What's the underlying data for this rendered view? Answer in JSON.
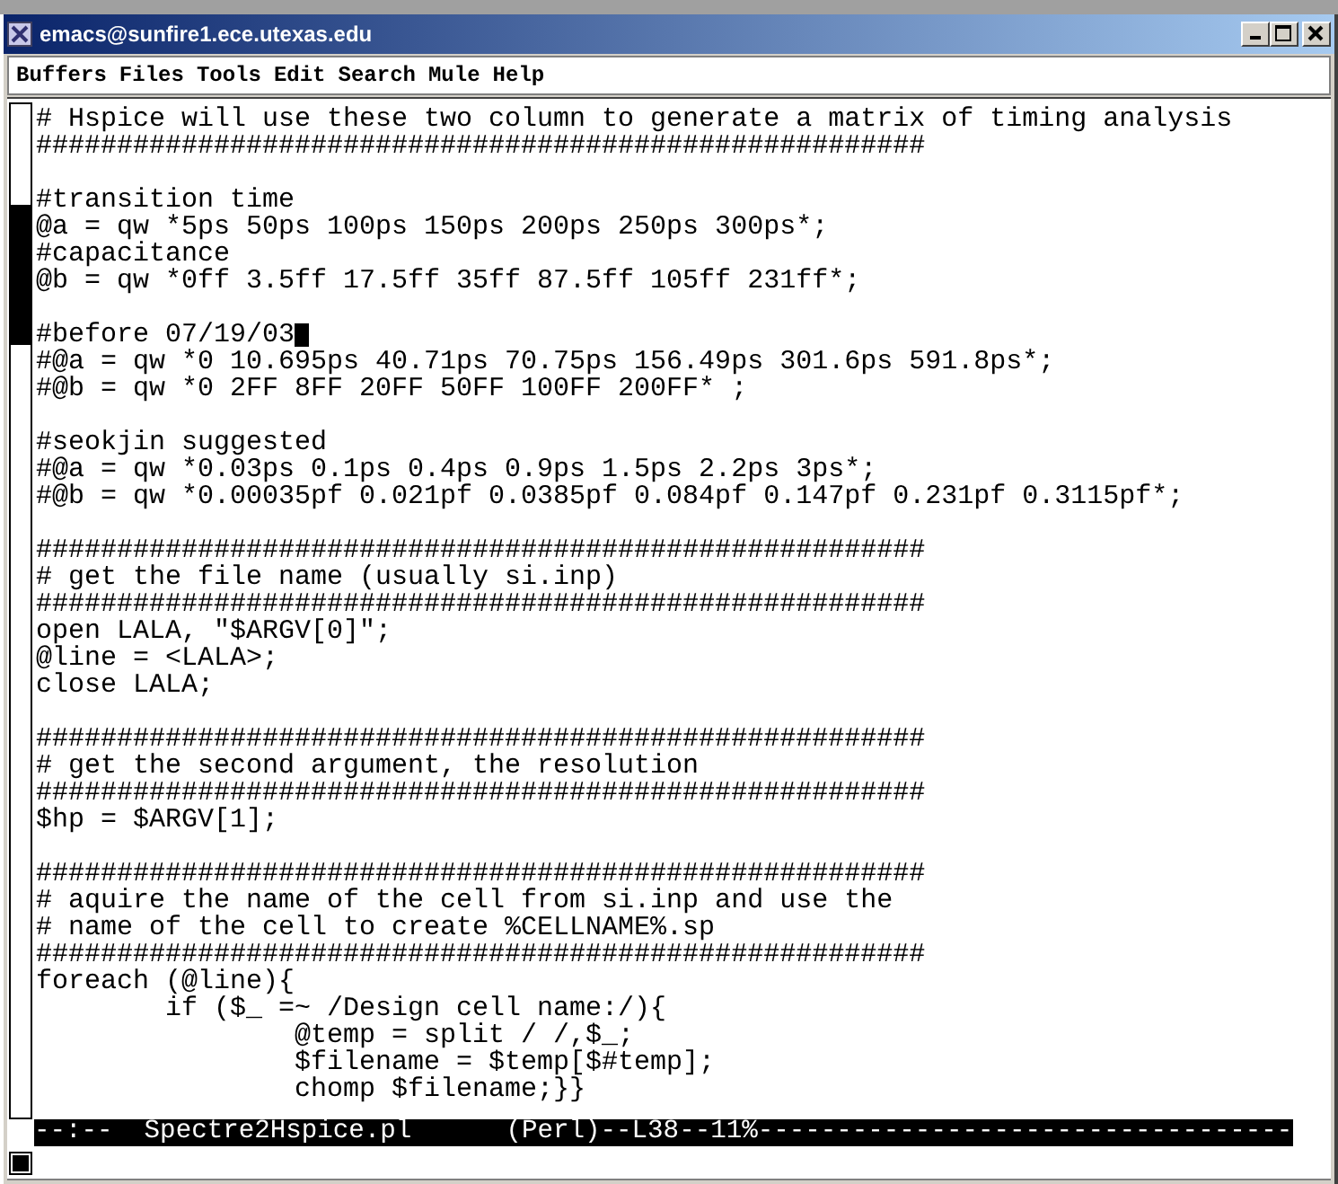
{
  "window": {
    "title": "emacs@sunfire1.ece.utexas.edu"
  },
  "menu": [
    "Buffers",
    "Files",
    "Tools",
    "Edit",
    "Search",
    "Mule",
    "Help"
  ],
  "buffer": {
    "blocks": [
      [
        {
          "text": "# Hspice will use these two column to generate a matrix of timing analysis",
          "cursor": false
        },
        {
          "text": "#######################################################",
          "cursor": false
        }
      ],
      [
        {
          "text": "#transition time",
          "cursor": false
        },
        {
          "text": "@a = qw *5ps 50ps 100ps 150ps 200ps 250ps 300ps*;",
          "cursor": false
        },
        {
          "text": "#capacitance",
          "cursor": false
        },
        {
          "text": "@b = qw *0ff 3.5ff 17.5ff 35ff 87.5ff 105ff 231ff*;",
          "cursor": false
        }
      ],
      [
        {
          "text": "#before 07/19/03",
          "cursor": true
        },
        {
          "text": "#@a = qw *0 10.695ps 40.71ps 70.75ps 156.49ps 301.6ps 591.8ps*;",
          "cursor": false
        },
        {
          "text": "#@b = qw *0 2FF 8FF 20FF 50FF 100FF 200FF* ;",
          "cursor": false
        }
      ],
      [
        {
          "text": "#seokjin suggested",
          "cursor": false
        },
        {
          "text": "#@a = qw *0.03ps 0.1ps 0.4ps 0.9ps 1.5ps 2.2ps 3ps*;",
          "cursor": false
        },
        {
          "text": "#@b = qw *0.00035pf 0.021pf 0.0385pf 0.084pf 0.147pf 0.231pf 0.3115pf*;",
          "cursor": false
        }
      ],
      [
        {
          "text": "#######################################################",
          "cursor": false
        },
        {
          "text": "# get the file name (usually si.inp)",
          "cursor": false
        },
        {
          "text": "#######################################################",
          "cursor": false
        },
        {
          "text": "open LALA, \"$ARGV[0]\";",
          "cursor": false
        },
        {
          "text": "@line = <LALA>;",
          "cursor": false
        },
        {
          "text": "close LALA;",
          "cursor": false
        }
      ],
      [
        {
          "text": "#######################################################",
          "cursor": false
        },
        {
          "text": "# get the second argument, the resolution",
          "cursor": false
        },
        {
          "text": "#######################################################",
          "cursor": false
        },
        {
          "text": "$hp = $ARGV[1];",
          "cursor": false
        }
      ],
      [
        {
          "text": "#######################################################",
          "cursor": false
        },
        {
          "text": "# aquire the name of the cell from si.inp and use the",
          "cursor": false
        },
        {
          "text": "# name of the cell to create %CELLNAME%.sp",
          "cursor": false
        },
        {
          "text": "#######################################################",
          "cursor": false
        },
        {
          "text": "foreach (@line){",
          "cursor": false
        },
        {
          "text": "        if ($_ =~ /Design cell name:/){",
          "cursor": false
        },
        {
          "text": "                @temp = split / /,$_;",
          "cursor": false
        },
        {
          "text": "                $filename = $temp[$#temp];",
          "cursor": false
        },
        {
          "text": "                chomp $filename;}}",
          "cursor": false
        }
      ]
    ]
  },
  "mode_line": "--:--  Spectre2Hspice.pl      (Perl)--L38--11%----------------------------------"
}
